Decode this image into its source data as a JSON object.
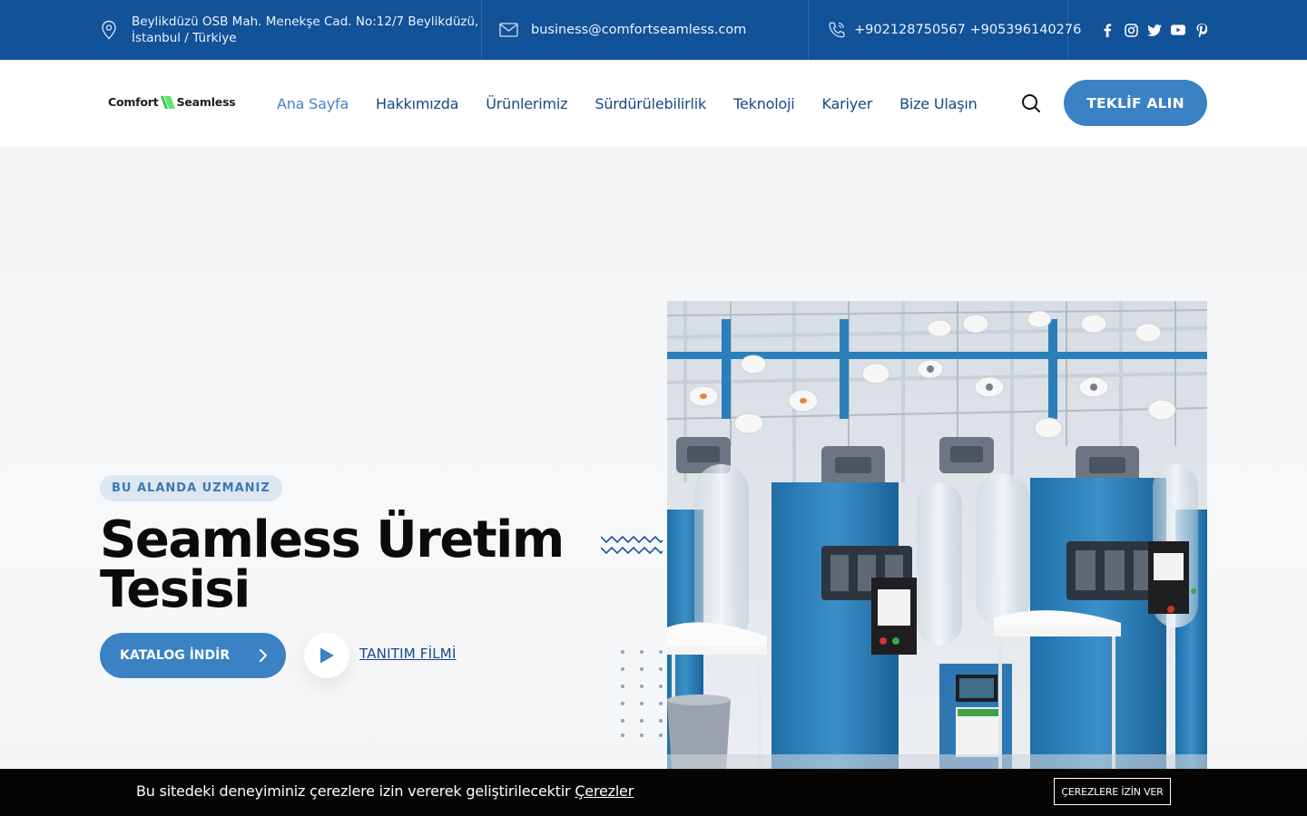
{
  "topbar": {
    "address_line1": "Beylikdüzü OSB Mah. Menekşe Cad. No:12/7 Beylikdüzü,",
    "address_line2": "İstanbul / Türkiye",
    "email": "business@comfortseamless.com",
    "phone": "+902128750567 +905396140276",
    "social": [
      "facebook-icon",
      "instagram-icon",
      "twitter-icon",
      "youtube-icon",
      "pinterest-icon"
    ]
  },
  "brand": {
    "word1": "Comfort",
    "word2": "Seamless",
    "accent": "#2ecc40"
  },
  "nav": {
    "items": [
      "Ana Sayfa",
      "Hakkımızda",
      "Ürünlerimiz",
      "Sürdürülebilirlik",
      "Teknoloji",
      "Kariyer",
      "Bize Ulaşın"
    ],
    "active": 0,
    "cta": "TEKLİF ALIN"
  },
  "hero": {
    "badge": "BU ALANDA UZMANIZ",
    "title_line1": "Seamless Üretim",
    "title_line2": "Tesisi",
    "catalog_button": "KATALOG İNDİR",
    "film_link": "TANITIM FİLMİ"
  },
  "cookie": {
    "message": "Bu sitedeki deneyiminiz çerezlere izin vererek geliştirilecektir",
    "link": "Çerezler",
    "accept": "ÇEREZLERE İZİN VER"
  },
  "colors": {
    "topbar": "#115299",
    "primary": "#3b82c4",
    "nav": "#134a86",
    "nav_active": "#3f86c8"
  }
}
